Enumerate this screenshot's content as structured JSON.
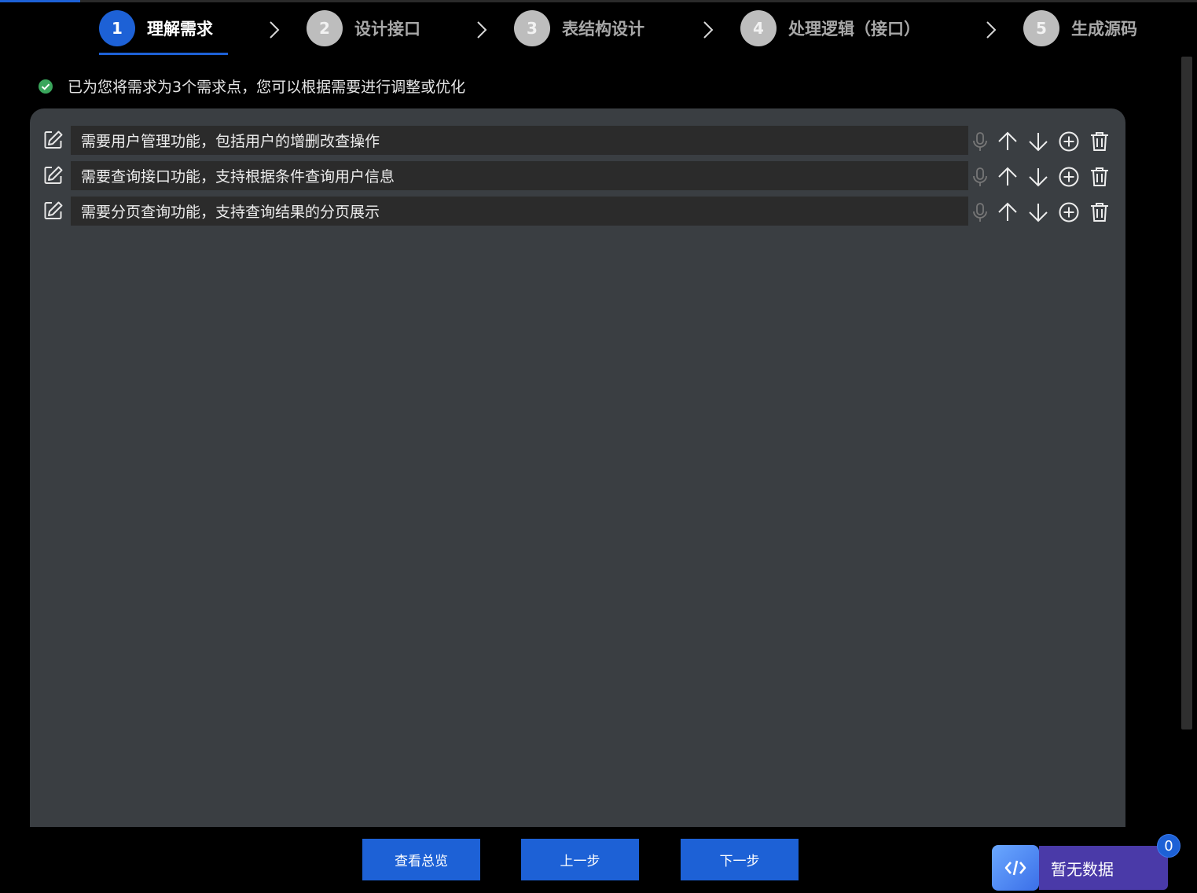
{
  "steps": [
    {
      "num": "1",
      "label": "理解需求",
      "active": true
    },
    {
      "num": "2",
      "label": "设计接口",
      "active": false
    },
    {
      "num": "3",
      "label": "表结构设计",
      "active": false
    },
    {
      "num": "4",
      "label": "处理逻辑（接口）",
      "active": false
    },
    {
      "num": "5",
      "label": "生成源码",
      "active": false
    }
  ],
  "info": {
    "text": "已为您将需求为3个需求点，您可以根据需要进行调整或优化"
  },
  "requirements": [
    {
      "text": "需要用户管理功能，包括用户的增删改查操作"
    },
    {
      "text": "需要查询接口功能，支持根据条件查询用户信息"
    },
    {
      "text": "需要分页查询功能，支持查询结果的分页展示"
    }
  ],
  "buttons": {
    "overview": "查看总览",
    "prev": "上一步",
    "next": "下一步"
  },
  "widget": {
    "label": "暂无数据",
    "badge": "0"
  },
  "colors": {
    "accent": "#1d61d6",
    "panel": "#3a3e42",
    "success": "#3aa65c",
    "widget": "#4a3aa8"
  }
}
